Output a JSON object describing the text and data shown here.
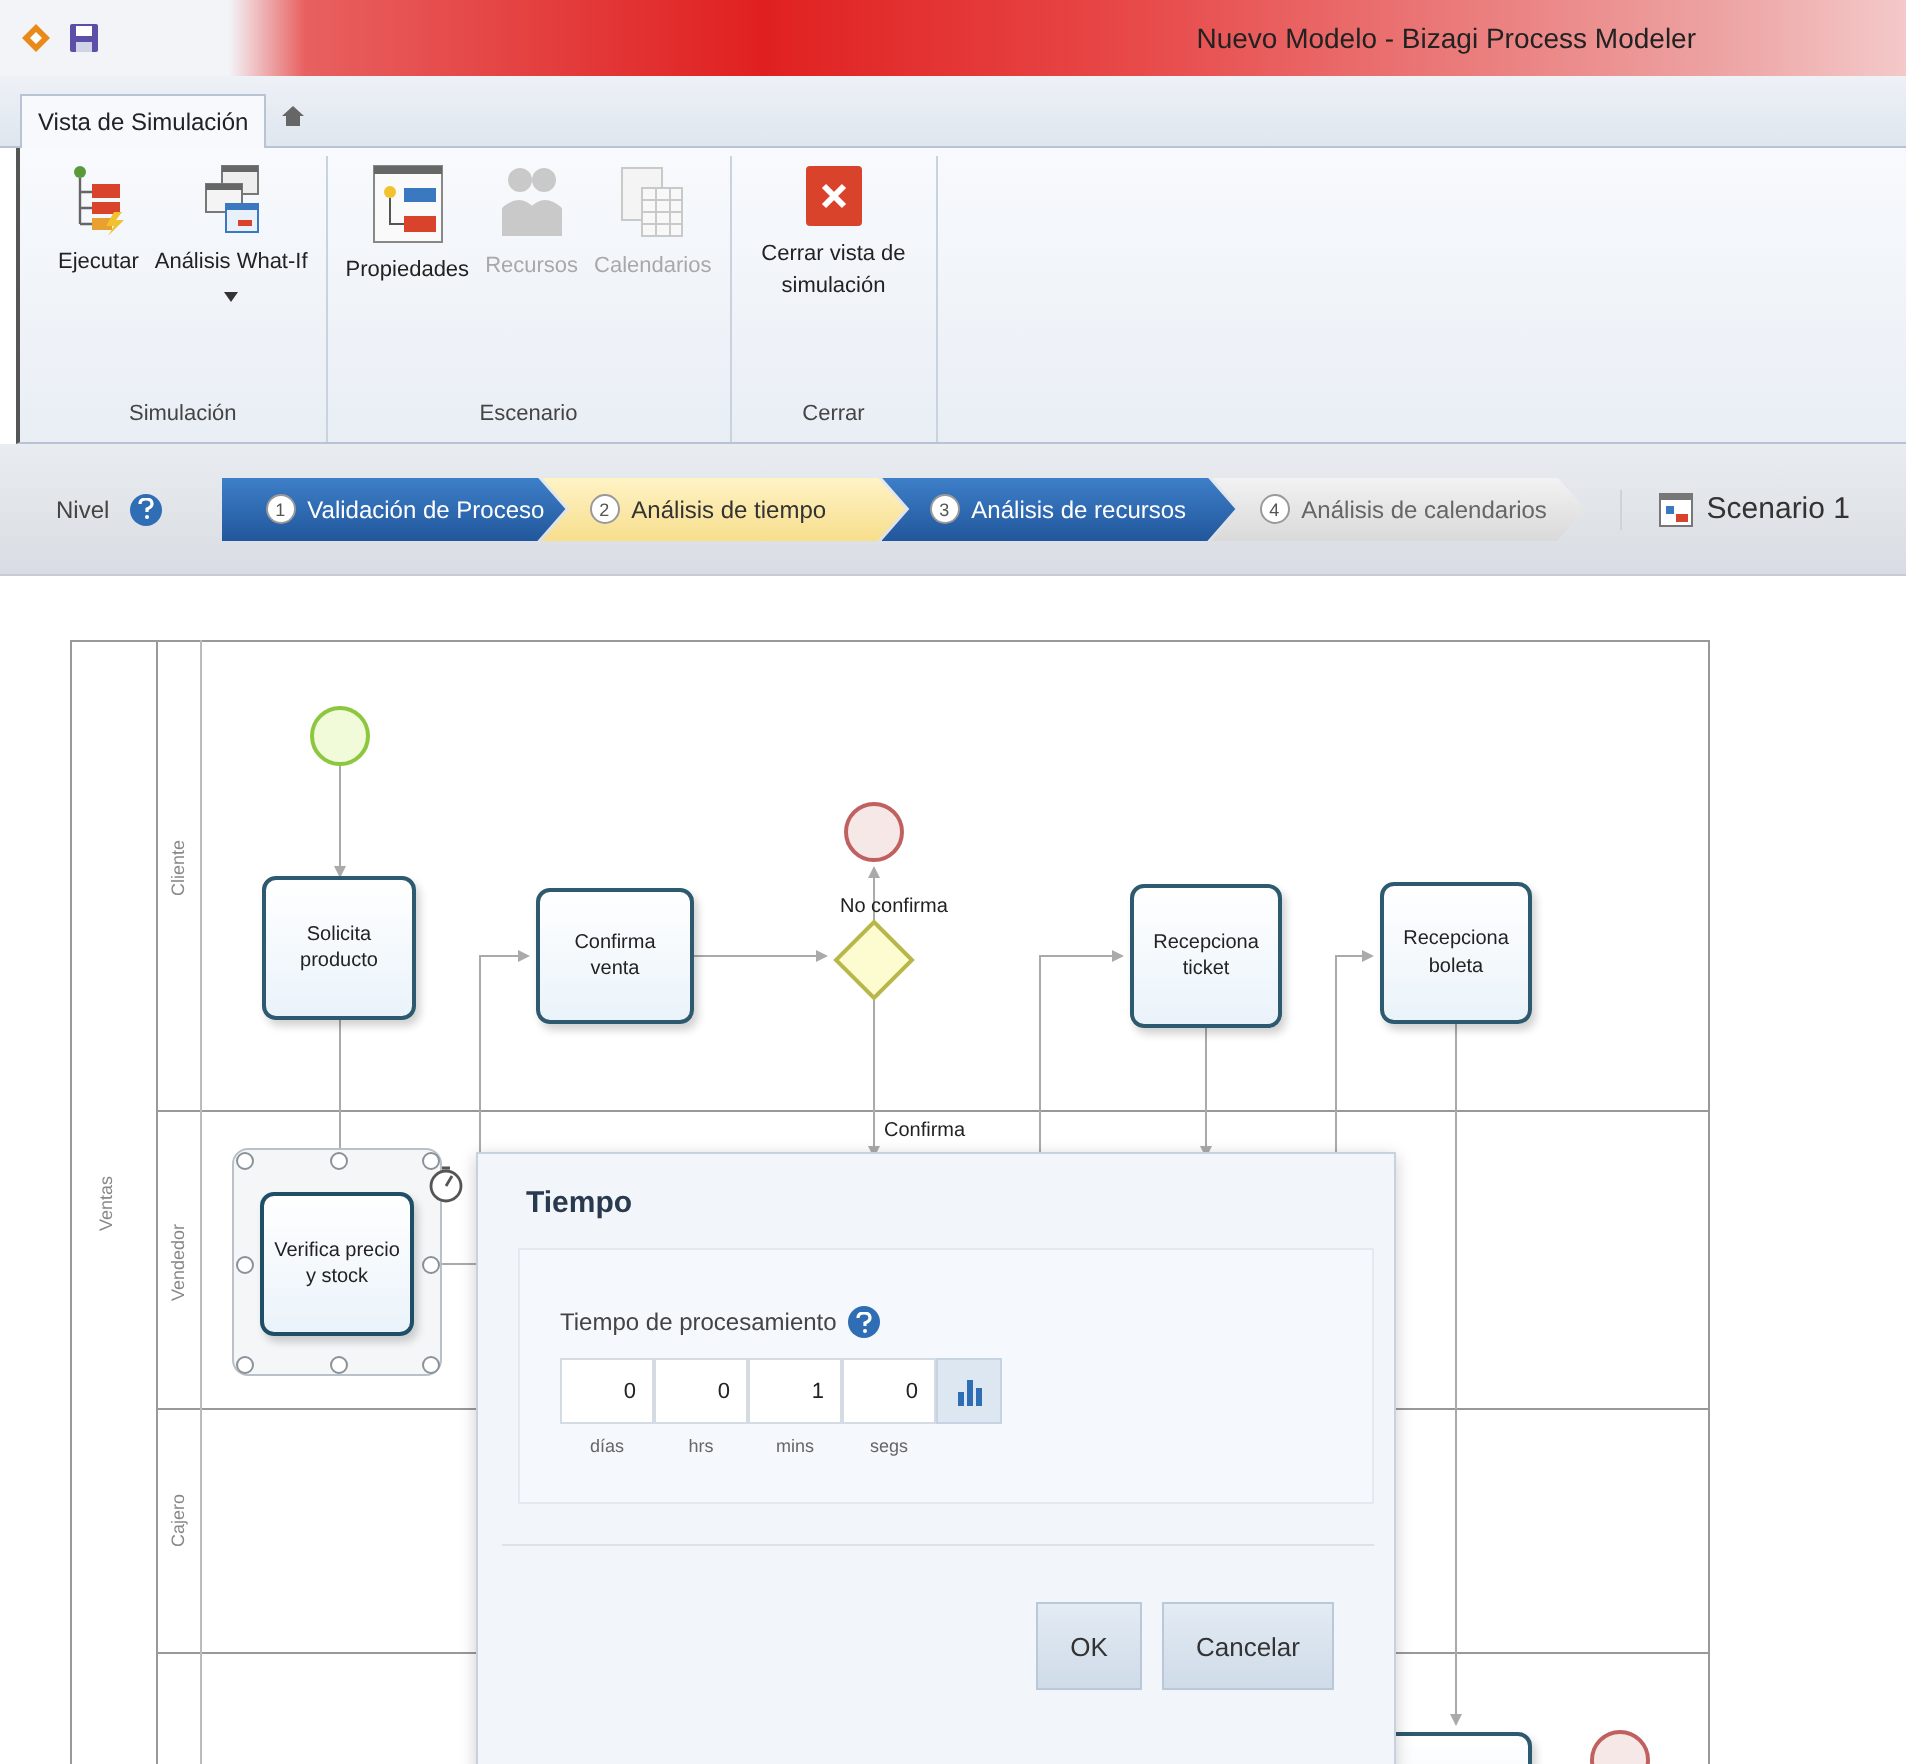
{
  "window": {
    "title": "Nuevo Modelo - Bizagi Process Modeler"
  },
  "ribbon_tabs": [
    {
      "label": "Vista de Simulación",
      "selected": true
    }
  ],
  "ribbon_groups": [
    {
      "label": "Simulación",
      "buttons": [
        {
          "kind": "run",
          "label": "Ejecutar",
          "disabled": false,
          "dropdown": false
        },
        {
          "kind": "whatif",
          "label": "Análisis What-If",
          "disabled": false,
          "dropdown": true
        }
      ]
    },
    {
      "label": "Escenario",
      "buttons": [
        {
          "kind": "properties",
          "label": "Propiedades",
          "disabled": false,
          "dropdown": false
        },
        {
          "kind": "resources",
          "label": "Recursos",
          "disabled": true,
          "dropdown": false
        },
        {
          "kind": "calendars",
          "label": "Calendarios",
          "disabled": true,
          "dropdown": false
        }
      ]
    },
    {
      "label": "Cerrar",
      "buttons": [
        {
          "kind": "close",
          "label": "Cerrar vista de simulación",
          "disabled": false,
          "dropdown": false
        }
      ]
    }
  ],
  "levels": {
    "label": "Nivel",
    "steps": [
      {
        "number": "1",
        "label": "Validación de Proceso",
        "selected": false,
        "disabled": false
      },
      {
        "number": "2",
        "label": "Análisis de tiempo",
        "selected": true,
        "disabled": false
      },
      {
        "number": "3",
        "label": "Análisis de recursos",
        "selected": false,
        "disabled": false
      },
      {
        "number": "4",
        "label": "Análisis de calendarios",
        "selected": false,
        "disabled": true
      }
    ]
  },
  "scenario": {
    "label": "Scenario 1"
  },
  "diagram": {
    "pool": "Ventas",
    "lanes": [
      "Cliente",
      "Vendedor",
      "Cajero"
    ],
    "nodes": [
      {
        "kind": "start",
        "selected": false
      },
      {
        "kind": "task",
        "label": "Solicita producto",
        "selected": false
      },
      {
        "kind": "task",
        "label": "Confirma venta",
        "selected": false
      },
      {
        "kind": "end",
        "selected": false
      },
      {
        "kind": "gateway",
        "selected": false
      },
      {
        "kind": "task",
        "label": "Recepciona ticket",
        "selected": false
      },
      {
        "kind": "task",
        "label": "Recepciona boleta",
        "selected": false
      },
      {
        "kind": "task",
        "label": "Verifica precio y stock",
        "selected": true
      },
      {
        "kind": "task",
        "selected": false
      },
      {
        "kind": "end",
        "selected": false
      }
    ],
    "flow_labels": [
      "No confirma",
      "Confirma"
    ]
  },
  "dialog": {
    "title": "Tiempo",
    "field_label": "Tiempo de procesamiento",
    "fields": [
      {
        "value": "0",
        "unit": "días"
      },
      {
        "value": "0",
        "unit": "hrs"
      },
      {
        "value": "1",
        "unit": "mins"
      },
      {
        "value": "0",
        "unit": "segs"
      }
    ],
    "buttons": [
      "OK",
      "Cancelar"
    ]
  }
}
